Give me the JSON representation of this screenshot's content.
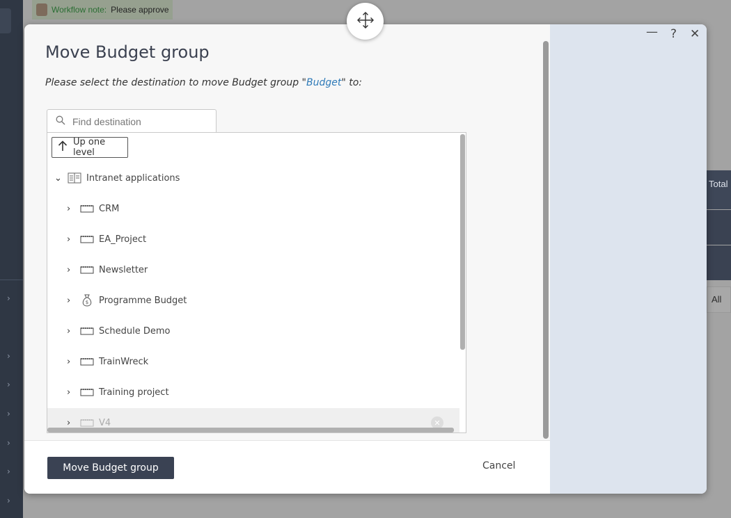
{
  "background": {
    "workflow_note_label": "Workflow note:",
    "workflow_note_text": "Please approve",
    "column_total": "Total",
    "filter_all": "All"
  },
  "dialog": {
    "title": "Move Budget group",
    "subtitle_before": "Please select the destination to move Budget group \"",
    "subtitle_link": "Budget",
    "subtitle_after": "\" to:",
    "window_controls": {
      "minimize": "—",
      "help": "?",
      "close": "✕"
    },
    "search_placeholder": "Find destination",
    "up_one_level": "Up one level",
    "tree": {
      "root": {
        "label": "Intranet applications",
        "icon": "application-icon",
        "expanded": true
      },
      "children": [
        {
          "label": "CRM",
          "icon": "project-icon"
        },
        {
          "label": "EA_Project",
          "icon": "project-icon"
        },
        {
          "label": "Newsletter",
          "icon": "project-icon"
        },
        {
          "label": "Programme Budget",
          "icon": "money-bag-icon"
        },
        {
          "label": "Schedule Demo",
          "icon": "project-icon"
        },
        {
          "label": "TrainWreck",
          "icon": "project-icon"
        },
        {
          "label": "Training project",
          "icon": "project-icon"
        },
        {
          "label": "V4",
          "icon": "project-icon"
        }
      ]
    },
    "primary_button": "Move Budget group",
    "cancel_button": "Cancel"
  }
}
